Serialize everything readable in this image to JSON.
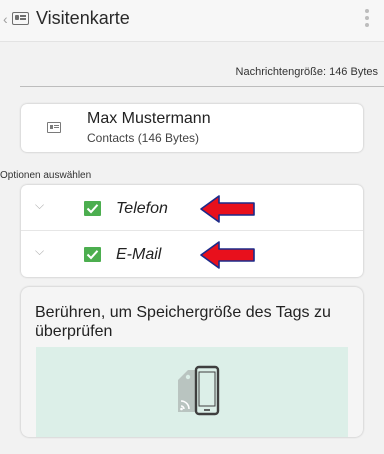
{
  "header": {
    "title": "Visitenkarte",
    "back_icon": "chevron-left-icon",
    "card_icon": "contact-card-icon",
    "menu_icon": "more-vert-icon"
  },
  "message": {
    "size_text": "Nachrichtengröße: 146 Bytes"
  },
  "contact": {
    "name": "Max Mustermann",
    "detail": "Contacts (146 Bytes)",
    "icon": "contact-card-icon"
  },
  "options": {
    "section_label": "Optionen auswählen",
    "items": [
      {
        "label": "Telefon",
        "checked": true,
        "expand_icon": "chevron-down-icon",
        "annotation_icon": "red-arrow-icon"
      },
      {
        "label": "E-Mail",
        "checked": true,
        "expand_icon": "chevron-down-icon",
        "annotation_icon": "red-arrow-icon"
      }
    ]
  },
  "scan": {
    "instruction": "Berühren, um Speichergröße des Tags zu überprüfen",
    "illustration_icon": "nfc-tag-phone-icon"
  },
  "colors": {
    "checkbox": "#4cae4f",
    "scan_area": "#dcefe8",
    "annotation_arrow": "#e8101c",
    "arrow_outline": "#1b2a8a"
  }
}
